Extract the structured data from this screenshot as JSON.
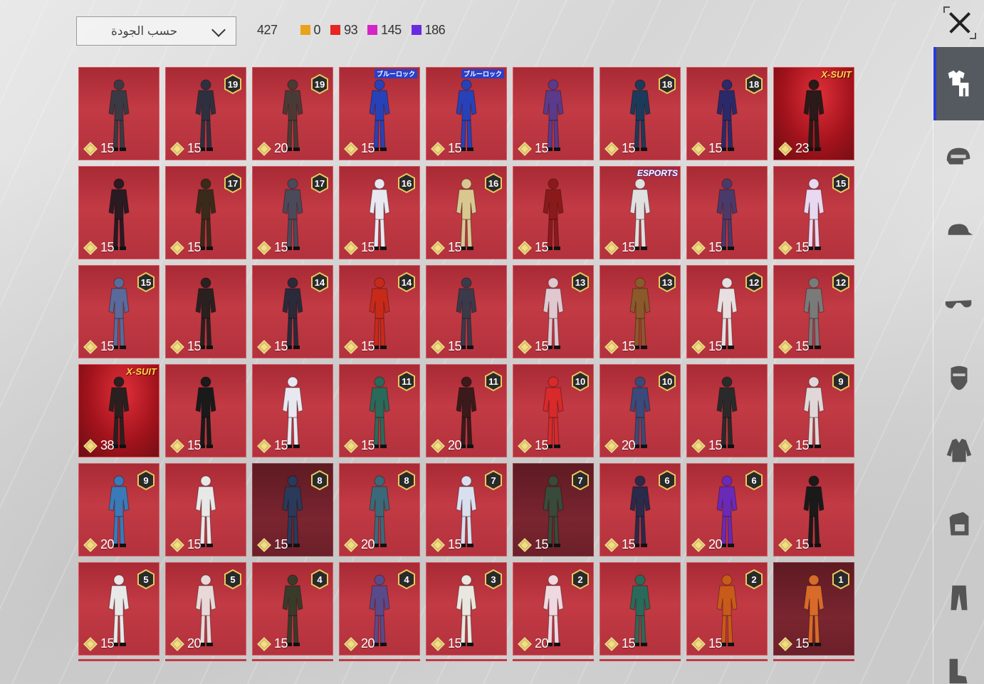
{
  "toolbar": {
    "sort_label": "حسب الجودة",
    "total": "427",
    "counts": [
      {
        "color": "#e8a31a",
        "value": "0"
      },
      {
        "color": "#e82424",
        "value": "93"
      },
      {
        "color": "#d424c8",
        "value": "145"
      },
      {
        "color": "#6a2ae0",
        "value": "186"
      }
    ]
  },
  "sidebar": {
    "items": [
      {
        "icon": "outfit-icon",
        "active": true
      },
      {
        "icon": "helmet-icon",
        "active": false
      },
      {
        "icon": "cap-icon",
        "active": false
      },
      {
        "icon": "glasses-icon",
        "active": false
      },
      {
        "icon": "mask-icon",
        "active": false
      },
      {
        "icon": "jacket-icon",
        "active": false
      },
      {
        "icon": "backpack-icon",
        "active": false
      },
      {
        "icon": "pants-icon",
        "active": false
      },
      {
        "icon": "boots-icon",
        "active": false
      }
    ]
  },
  "items": [
    {
      "cost": "15",
      "level": "",
      "tag": "",
      "dark": false,
      "figure": "#3a3a44"
    },
    {
      "cost": "15",
      "level": "19",
      "tag": "",
      "dark": false,
      "figure": "#2e3040"
    },
    {
      "cost": "20",
      "level": "19",
      "tag": "",
      "dark": false,
      "figure": "#4a3a35"
    },
    {
      "cost": "15",
      "level": "",
      "tag": "ブルーロック",
      "dark": false,
      "figure": "#2742b8"
    },
    {
      "cost": "15",
      "level": "",
      "tag": "ブルーロック",
      "dark": false,
      "figure": "#2742b8"
    },
    {
      "cost": "15",
      "level": "",
      "tag": "",
      "dark": false,
      "figure": "#5a3a8a"
    },
    {
      "cost": "15",
      "level": "18",
      "tag": "",
      "dark": false,
      "figure": "#1c3a5a"
    },
    {
      "cost": "15",
      "level": "18",
      "tag": "",
      "dark": false,
      "figure": "#2a2a6a"
    },
    {
      "cost": "23",
      "level": "",
      "tag": "X-SUIT",
      "dark": false,
      "figure": "#2a1a1a"
    },
    {
      "cost": "15",
      "level": "",
      "tag": "",
      "dark": false,
      "figure": "#2a1a22"
    },
    {
      "cost": "15",
      "level": "17",
      "tag": "",
      "dark": false,
      "figure": "#3a2a1a"
    },
    {
      "cost": "15",
      "level": "17",
      "tag": "",
      "dark": false,
      "figure": "#4a4a5a"
    },
    {
      "cost": "15",
      "level": "16",
      "tag": "",
      "dark": false,
      "figure": "#e8e8f0"
    },
    {
      "cost": "15",
      "level": "16",
      "tag": "",
      "dark": false,
      "figure": "#d8c890"
    },
    {
      "cost": "15",
      "level": "",
      "tag": "",
      "dark": false,
      "figure": "#8a1a1a"
    },
    {
      "cost": "15",
      "level": "",
      "tag": "ESPORTS",
      "dark": false,
      "figure": "#e0e0e0"
    },
    {
      "cost": "15",
      "level": "",
      "tag": "",
      "dark": false,
      "figure": "#4a3a6a"
    },
    {
      "cost": "15",
      "level": "15",
      "tag": "",
      "dark": false,
      "figure": "#e8d8f0"
    },
    {
      "cost": "15",
      "level": "15",
      "tag": "",
      "dark": false,
      "figure": "#5a6a9a"
    },
    {
      "cost": "15",
      "level": "",
      "tag": "",
      "dark": false,
      "figure": "#2a2020"
    },
    {
      "cost": "15",
      "level": "14",
      "tag": "",
      "dark": false,
      "figure": "#2a2a3a"
    },
    {
      "cost": "15",
      "level": "14",
      "tag": "",
      "dark": false,
      "figure": "#c82a1a"
    },
    {
      "cost": "15",
      "level": "",
      "tag": "",
      "dark": false,
      "figure": "#3a3a4a"
    },
    {
      "cost": "15",
      "level": "13",
      "tag": "",
      "dark": false,
      "figure": "#e0c8d0"
    },
    {
      "cost": "15",
      "level": "13",
      "tag": "",
      "dark": false,
      "figure": "#8a5a2a"
    },
    {
      "cost": "15",
      "level": "12",
      "tag": "",
      "dark": false,
      "figure": "#e8e0e0"
    },
    {
      "cost": "15",
      "level": "12",
      "tag": "",
      "dark": false,
      "figure": "#7a7a7a"
    },
    {
      "cost": "38",
      "level": "",
      "tag": "X-SUIT",
      "dark": false,
      "figure": "#2a2020"
    },
    {
      "cost": "15",
      "level": "",
      "tag": "",
      "dark": false,
      "figure": "#1a1a1a"
    },
    {
      "cost": "15",
      "level": "",
      "tag": "",
      "dark": false,
      "figure": "#e8e8f0"
    },
    {
      "cost": "15",
      "level": "11",
      "tag": "",
      "dark": false,
      "figure": "#2a6a5a"
    },
    {
      "cost": "20",
      "level": "11",
      "tag": "",
      "dark": false,
      "figure": "#3a1a1a"
    },
    {
      "cost": "15",
      "level": "10",
      "tag": "",
      "dark": false,
      "figure": "#d82a2a"
    },
    {
      "cost": "20",
      "level": "10",
      "tag": "",
      "dark": false,
      "figure": "#3a4a7a"
    },
    {
      "cost": "15",
      "level": "",
      "tag": "",
      "dark": false,
      "figure": "#2a2a2a"
    },
    {
      "cost": "15",
      "level": "9",
      "tag": "",
      "dark": false,
      "figure": "#e0d8d8"
    },
    {
      "cost": "20",
      "level": "9",
      "tag": "",
      "dark": false,
      "figure": "#3a7ab8"
    },
    {
      "cost": "15",
      "level": "",
      "tag": "",
      "dark": false,
      "figure": "#e8e8e8"
    },
    {
      "cost": "15",
      "level": "8",
      "tag": "",
      "dark": true,
      "figure": "#2a3a5a"
    },
    {
      "cost": "20",
      "level": "8",
      "tag": "",
      "dark": false,
      "figure": "#3a6a7a"
    },
    {
      "cost": "15",
      "level": "7",
      "tag": "",
      "dark": false,
      "figure": "#d8e0f0"
    },
    {
      "cost": "15",
      "level": "7",
      "tag": "",
      "dark": true,
      "figure": "#3a4a3a"
    },
    {
      "cost": "15",
      "level": "6",
      "tag": "",
      "dark": false,
      "figure": "#2a2a4a"
    },
    {
      "cost": "20",
      "level": "6",
      "tag": "",
      "dark": false,
      "figure": "#6a2ab8"
    },
    {
      "cost": "15",
      "level": "",
      "tag": "",
      "dark": false,
      "figure": "#1a1a1a"
    },
    {
      "cost": "15",
      "level": "5",
      "tag": "",
      "dark": false,
      "figure": "#e8e8e8"
    },
    {
      "cost": "20",
      "level": "5",
      "tag": "",
      "dark": false,
      "figure": "#e8d8d8"
    },
    {
      "cost": "15",
      "level": "4",
      "tag": "",
      "dark": false,
      "figure": "#3a3a2a"
    },
    {
      "cost": "20",
      "level": "4",
      "tag": "",
      "dark": false,
      "figure": "#5a4a8a"
    },
    {
      "cost": "15",
      "level": "3",
      "tag": "",
      "dark": false,
      "figure": "#e8e8e0"
    },
    {
      "cost": "20",
      "level": "2",
      "tag": "",
      "dark": false,
      "figure": "#f0d8e0"
    },
    {
      "cost": "15",
      "level": "",
      "tag": "",
      "dark": false,
      "figure": "#2a6a5a"
    },
    {
      "cost": "15",
      "level": "2",
      "tag": "",
      "dark": false,
      "figure": "#c85a1a"
    },
    {
      "cost": "15",
      "level": "1",
      "tag": "",
      "dark": true,
      "figure": "#d86a2a"
    }
  ]
}
